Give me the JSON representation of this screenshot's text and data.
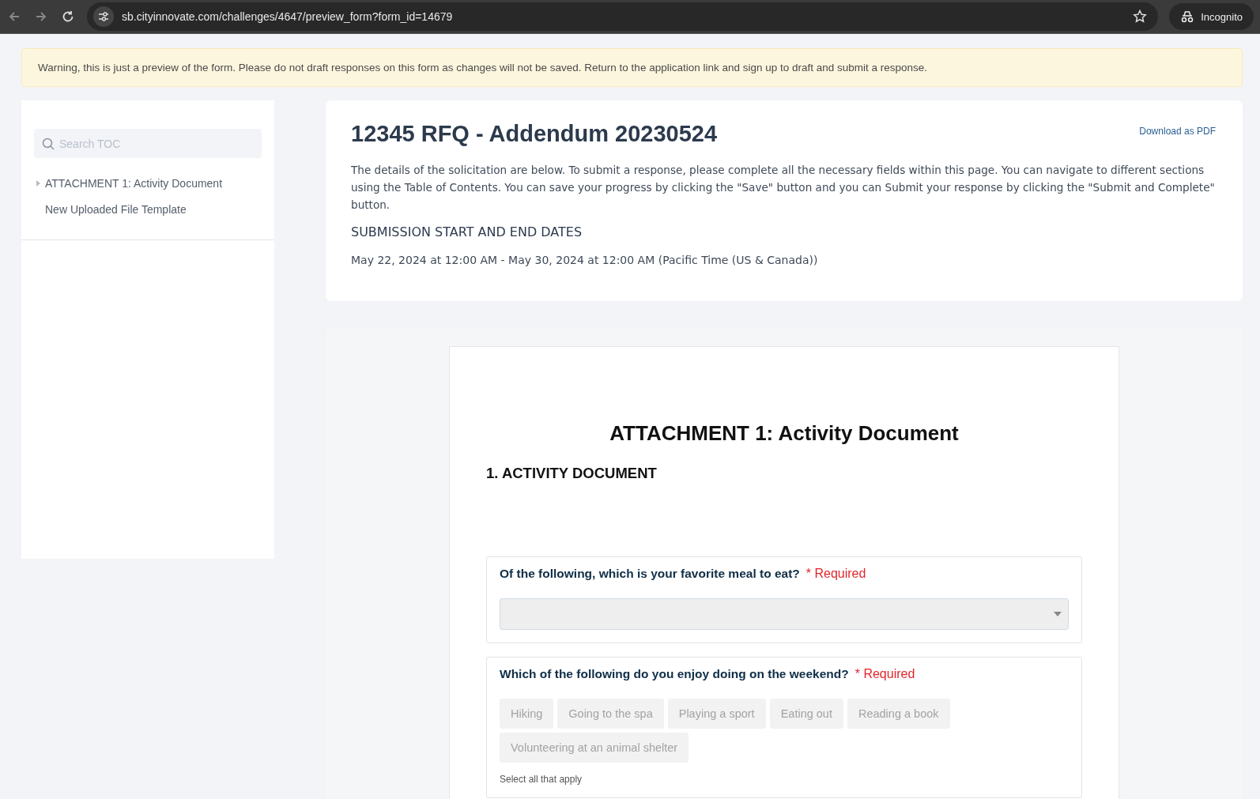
{
  "browser": {
    "url": "sb.cityinnovate.com/challenges/4647/preview_form?form_id=14679",
    "profile": "Incognito"
  },
  "warning": "Warning, this is just a preview of the form. Please do not draft responses on this form as changes will not be saved. Return to the application link and sign up to draft and submit a response.",
  "sidebar": {
    "search": {
      "placeholder": "Search TOC"
    },
    "items": [
      {
        "label": "ATTACHMENT 1: Activity Document",
        "kind": "group",
        "expanded": false
      },
      {
        "label": "New Uploaded File Template",
        "kind": "leaf"
      }
    ]
  },
  "header": {
    "title": "12345 RFQ - Addendum 20230524",
    "download": "Download as PDF",
    "description": "The details of the solicitation are below. To submit a response, please complete all the necessary fields within this page. You can navigate to different sections using the Table of Contents. You can save your progress by clicking the \"Save\" button and you can Submit your response by clicking the \"Submit and Complete\" button.",
    "dates_heading": "SUBMISSION START AND END DATES",
    "dates": "May 22, 2024 at 12:00 AM - May 30, 2024 at 12:00 AM (Pacific Time (US & Canada))"
  },
  "document": {
    "title": "ATTACHMENT 1: Activity Document",
    "section": "1. ACTIVITY DOCUMENT",
    "questions": [
      {
        "kind": "dropdown",
        "label": "Of the following, which is your favorite meal to eat?",
        "required": "* Required"
      },
      {
        "kind": "choices",
        "label": "Which of the following do you enjoy doing on the weekend?",
        "required": "* Required",
        "options": [
          {
            "label": "Hiking",
            "selected": false
          },
          {
            "label": "Going to the spa",
            "selected": false
          },
          {
            "label": "Playing a sport",
            "selected": false
          },
          {
            "label": "Eating out",
            "selected": false
          },
          {
            "label": "Reading a book",
            "selected": false
          },
          {
            "label": "Volunteering at an animal shelter",
            "selected": false
          }
        ],
        "hint": "Select all that apply"
      }
    ]
  }
}
